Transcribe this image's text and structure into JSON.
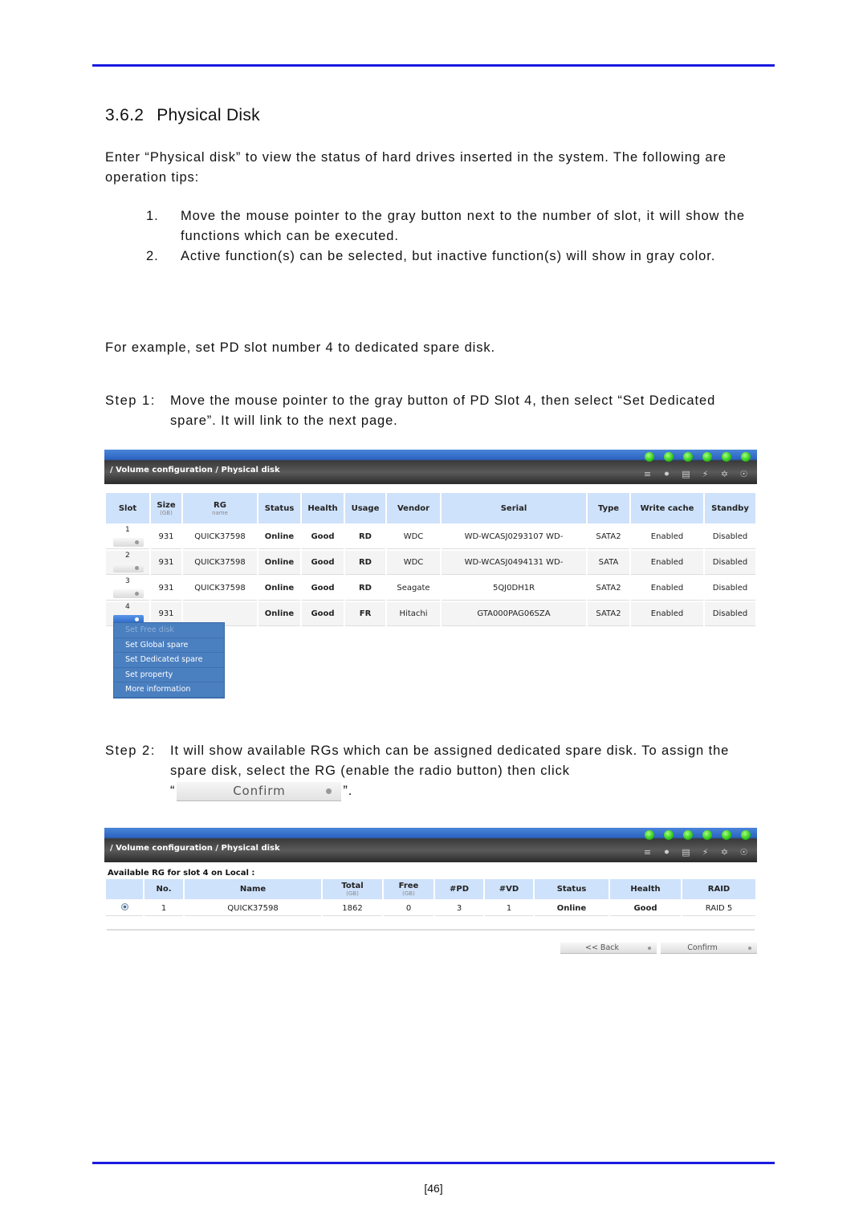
{
  "section": {
    "number": "3.6.2",
    "title": "Physical Disk"
  },
  "intro": "Enter “Physical disk” to view the status of hard drives inserted in the system. The following are operation tips:",
  "tips": [
    {
      "n": "1.",
      "text": "Move the mouse pointer to the gray button next to the number of slot, it will show the functions which can be executed."
    },
    {
      "n": "2.",
      "text": "Active function(s) can be selected, but inactive function(s) will show in gray color."
    }
  ],
  "example": "For example, set PD slot number 4 to dedicated spare disk.",
  "step1": {
    "label": "Step 1:",
    "text": "Move the mouse pointer to the gray button of PD Slot 4, then select “Set Dedicated spare”.  It will link to the next page."
  },
  "step2": {
    "label": "Step 2:",
    "text": "It will show available RGs which can be assigned dedicated spare disk. To assign the spare disk, select the RG (enable the radio button) then click",
    "open_quote": "“",
    "close_quote": "”.",
    "button_label": "Confirm"
  },
  "screen1": {
    "breadcrumb": "/ Volume configuration / Physical disk",
    "status_icons": [
      "disk-icon",
      "thermometer-icon",
      "ups-icon",
      "voltage-icon",
      "fan-icon",
      "power-icon"
    ],
    "headers": [
      {
        "label": "Slot",
        "sub": ""
      },
      {
        "label": "Size",
        "sub": "(GB)"
      },
      {
        "label": "RG",
        "sub": "name"
      },
      {
        "label": "Status",
        "sub": ""
      },
      {
        "label": "Health",
        "sub": ""
      },
      {
        "label": "Usage",
        "sub": ""
      },
      {
        "label": "Vendor",
        "sub": ""
      },
      {
        "label": "Serial",
        "sub": ""
      },
      {
        "label": "Type",
        "sub": ""
      },
      {
        "label": "Write cache",
        "sub": ""
      },
      {
        "label": "Standby",
        "sub": ""
      }
    ],
    "rows": [
      {
        "slot": "1",
        "size": "931",
        "rg": "QUICK37598",
        "status": "Online",
        "health": "Good",
        "usage": "RD",
        "vendor": "WDC",
        "serial": "WD-WCASJ0293107 WD-",
        "type": "SATA2",
        "write_cache": "Enabled",
        "standby": "Disabled"
      },
      {
        "slot": "2",
        "size": "931",
        "rg": "QUICK37598",
        "status": "Online",
        "health": "Good",
        "usage": "RD",
        "vendor": "WDC",
        "serial": "WD-WCASJ0494131 WD-",
        "type": "SATA",
        "write_cache": "Enabled",
        "standby": "Disabled"
      },
      {
        "slot": "3",
        "size": "931",
        "rg": "QUICK37598",
        "status": "Online",
        "health": "Good",
        "usage": "RD",
        "vendor": "Seagate",
        "serial": "5QJ0DH1R",
        "type": "SATA2",
        "write_cache": "Enabled",
        "standby": "Disabled"
      },
      {
        "slot": "4",
        "size": "931",
        "rg": "",
        "status": "Online",
        "health": "Good",
        "usage": "FR",
        "vendor": "Hitachi",
        "serial": "GTA000PAG06SZA",
        "type": "SATA2",
        "write_cache": "Enabled",
        "standby": "Disabled"
      }
    ],
    "menu": [
      {
        "label": "Set Free disk",
        "enabled": false
      },
      {
        "label": "Set Global spare",
        "enabled": true
      },
      {
        "label": "Set Dedicated spare",
        "enabled": true
      },
      {
        "label": "Set property",
        "enabled": true
      },
      {
        "label": "More information",
        "enabled": true
      }
    ]
  },
  "screen2": {
    "breadcrumb": "/ Volume configuration / Physical disk",
    "caption": "Available RG for slot 4 on Local :",
    "headers": [
      {
        "label": "",
        "sub": ""
      },
      {
        "label": "No.",
        "sub": ""
      },
      {
        "label": "Name",
        "sub": ""
      },
      {
        "label": "Total",
        "sub": "(GB)"
      },
      {
        "label": "Free",
        "sub": "(GB)"
      },
      {
        "label": "#PD",
        "sub": ""
      },
      {
        "label": "#VD",
        "sub": ""
      },
      {
        "label": "Status",
        "sub": ""
      },
      {
        "label": "Health",
        "sub": ""
      },
      {
        "label": "RAID",
        "sub": ""
      }
    ],
    "rows": [
      {
        "selected": true,
        "no": "1",
        "name": "QUICK37598",
        "total": "1862",
        "free": "0",
        "pd": "3",
        "vd": "1",
        "status": "Online",
        "health": "Good",
        "raid": "RAID 5"
      }
    ],
    "back_label": "<< Back",
    "confirm_label": "Confirm"
  },
  "page_number": "[46]"
}
